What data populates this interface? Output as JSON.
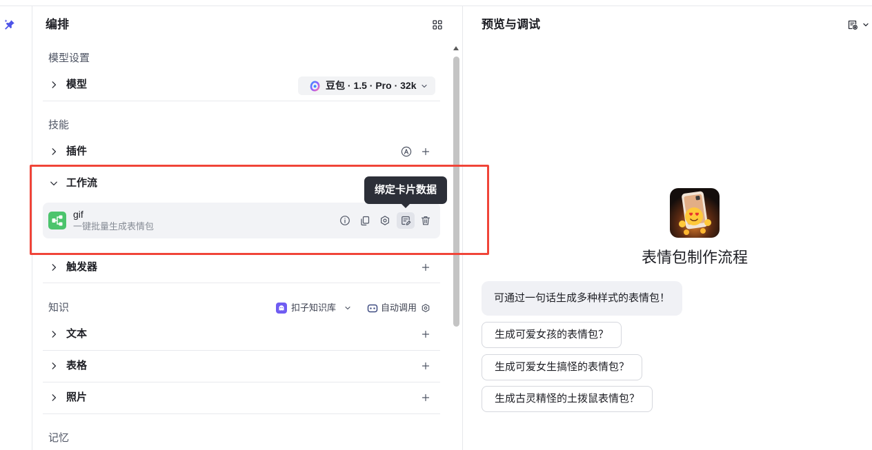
{
  "colors": {
    "accent": "#4d53e8",
    "annotation_border": "#f04438",
    "workflow_icon_bg": "#4cc46d",
    "knowledge_icon_bg": "#6f5cf2",
    "tooltip_bg": "#2c2f38",
    "card_bg": "#f2f3f6"
  },
  "rail": {
    "icon": "pin-sparkle-icon"
  },
  "orchestration": {
    "title": "编排",
    "layout_icon": "grid-layout-icon",
    "model_settings": {
      "label": "模型设置",
      "model": {
        "label": "模型",
        "selected": "豆包 · 1.5 · Pro · 32k"
      }
    },
    "skills": {
      "label": "技能",
      "plugins": {
        "label": "插件",
        "expanded": false
      },
      "workflows": {
        "label": "工作流",
        "expanded": true,
        "items": [
          {
            "name": "gif",
            "description": "一键批量生成表情包",
            "action_icons": [
              "info",
              "copy",
              "settings",
              "bind-card-data",
              "delete"
            ]
          }
        ],
        "tooltip": "绑定卡片数据"
      },
      "triggers": {
        "label": "触发器",
        "expanded": false
      }
    },
    "knowledge": {
      "label": "知识",
      "source": "扣子知识库",
      "call_mode": "自动调用",
      "items": [
        {
          "label": "文本"
        },
        {
          "label": "表格"
        },
        {
          "label": "照片"
        }
      ]
    },
    "memory": {
      "label": "记忆"
    }
  },
  "preview": {
    "title": "预览与调试",
    "bot_name": "表情包制作流程",
    "opening_message": "可通过一句话生成多种样式的表情包！",
    "suggestions": [
      "生成可爱女孩的表情包？",
      "生成可爱女生搞怪的表情包？",
      "生成古灵精怪的土拨鼠表情包？"
    ]
  }
}
